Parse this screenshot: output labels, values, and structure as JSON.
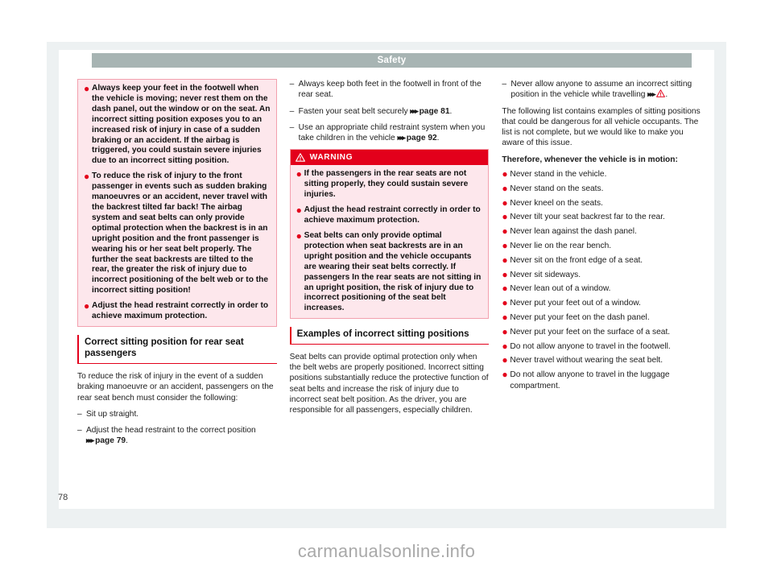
{
  "document": {
    "running_head": "Safety",
    "page_number": "78",
    "watermark": "carmanualsonline.info",
    "colors": {
      "accent_red": "#e3001b",
      "warning_bg": "#fde7ec",
      "warning_border": "#f3a0ae",
      "running_head_bg": "#a7b4b3",
      "page_bg": "#ffffff",
      "viewer_bg": "#edf1f2"
    }
  },
  "column1": {
    "warning_panel": {
      "bullets": [
        "Always keep your feet in the footwell when the vehicle is moving; never rest them on the dash panel, out the window or on the seat. An incorrect sitting position exposes you to an increased risk of injury in case of a sudden braking or an accident. If the airbag is triggered, you could sustain severe injuries due to an incorrect sitting position.",
        "To reduce the risk of injury to the front passenger in events such as sudden braking manoeuvres or an accident, never travel with the backrest tilted far back! The airbag system and seat belts can only provide optimal protection when the backrest is in an upright position and the front passenger is wearing his or her seat belt properly. The further the seat backrests are tilted to the rear, the greater the risk of injury due to incorrect positioning of the belt web or to the incorrect sitting position!",
        "Adjust the head restraint correctly in order to achieve maximum protection."
      ]
    },
    "section": {
      "heading": "Correct sitting position for rear seat passengers",
      "intro": "To reduce the risk of injury in the event of a sudden braking manoeuvre or an accident, passengers on the rear seat bench must consider the following:",
      "items": [
        {
          "dash": "–",
          "text": "Sit up straight."
        },
        {
          "dash": "–",
          "text": "Adjust the head restraint to the correct position ",
          "ref": "page 79",
          "after": "."
        }
      ]
    }
  },
  "column2": {
    "items": [
      {
        "dash": "–",
        "text": "Always keep both feet in the footwell in front of the rear seat."
      },
      {
        "dash": "–",
        "text": "Fasten your seat belt securely ",
        "ref": "page 81",
        "after": "."
      },
      {
        "dash": "–",
        "text": "Use an appropriate child restraint system when you take children in the vehicle ",
        "ref": "page 92",
        "after": "."
      }
    ],
    "warning": {
      "title": "WARNING",
      "icon": "warning-triangle-icon",
      "bullets": [
        "If the passengers in the rear seats are not sitting properly, they could sustain severe injuries.",
        "Adjust the head restraint correctly in order to achieve maximum protection.",
        "Seat belts can only provide optimal protection when seat backrests are in an upright position and the vehicle occupants are wearing their seat belts correctly. If passengers In the rear seats are not sitting in an upright position, the risk of injury due to incorrect positioning of the seat belt increases."
      ]
    },
    "section": {
      "heading": "Examples of incorrect sitting positions",
      "intro": "Seat belts can provide optimal protection only when the belt webs are properly positioned. Incorrect sitting positions substantially reduce the protective function of seat belts and increase the risk of injury due to incorrect seat belt position. As the driver, you are responsible for all passengers, especially children."
    }
  },
  "column3": {
    "lead_item": {
      "dash": "–",
      "text": "Never allow anyone to assume an incorrect sitting position in the vehicle while travelling ",
      "ref_icon": "warning-triangle-icon",
      "after": "."
    },
    "paragraph": "The following list contains examples of sitting positions that could be dangerous for all vehicle occupants. The list is not complete, but we would like to make you aware of this issue.",
    "list_lead": "Therefore, whenever the vehicle is in motion:",
    "bullets": [
      "Never stand in the vehicle.",
      "Never stand on the seats.",
      "Never kneel on the seats.",
      "Never tilt your seat backrest far to the rear.",
      "Never lean against the dash panel.",
      "Never lie on the rear bench.",
      "Never sit on the front edge of a seat.",
      "Never sit sideways.",
      "Never lean out of a window.",
      "Never put your feet out of a window.",
      "Never put your feet on the dash panel.",
      "Never put your feet on the surface of a seat.",
      "Do not allow anyone to travel in the footwell.",
      "Never travel without wearing the seat belt.",
      "Do not allow anyone to travel in the luggage compartment."
    ]
  }
}
